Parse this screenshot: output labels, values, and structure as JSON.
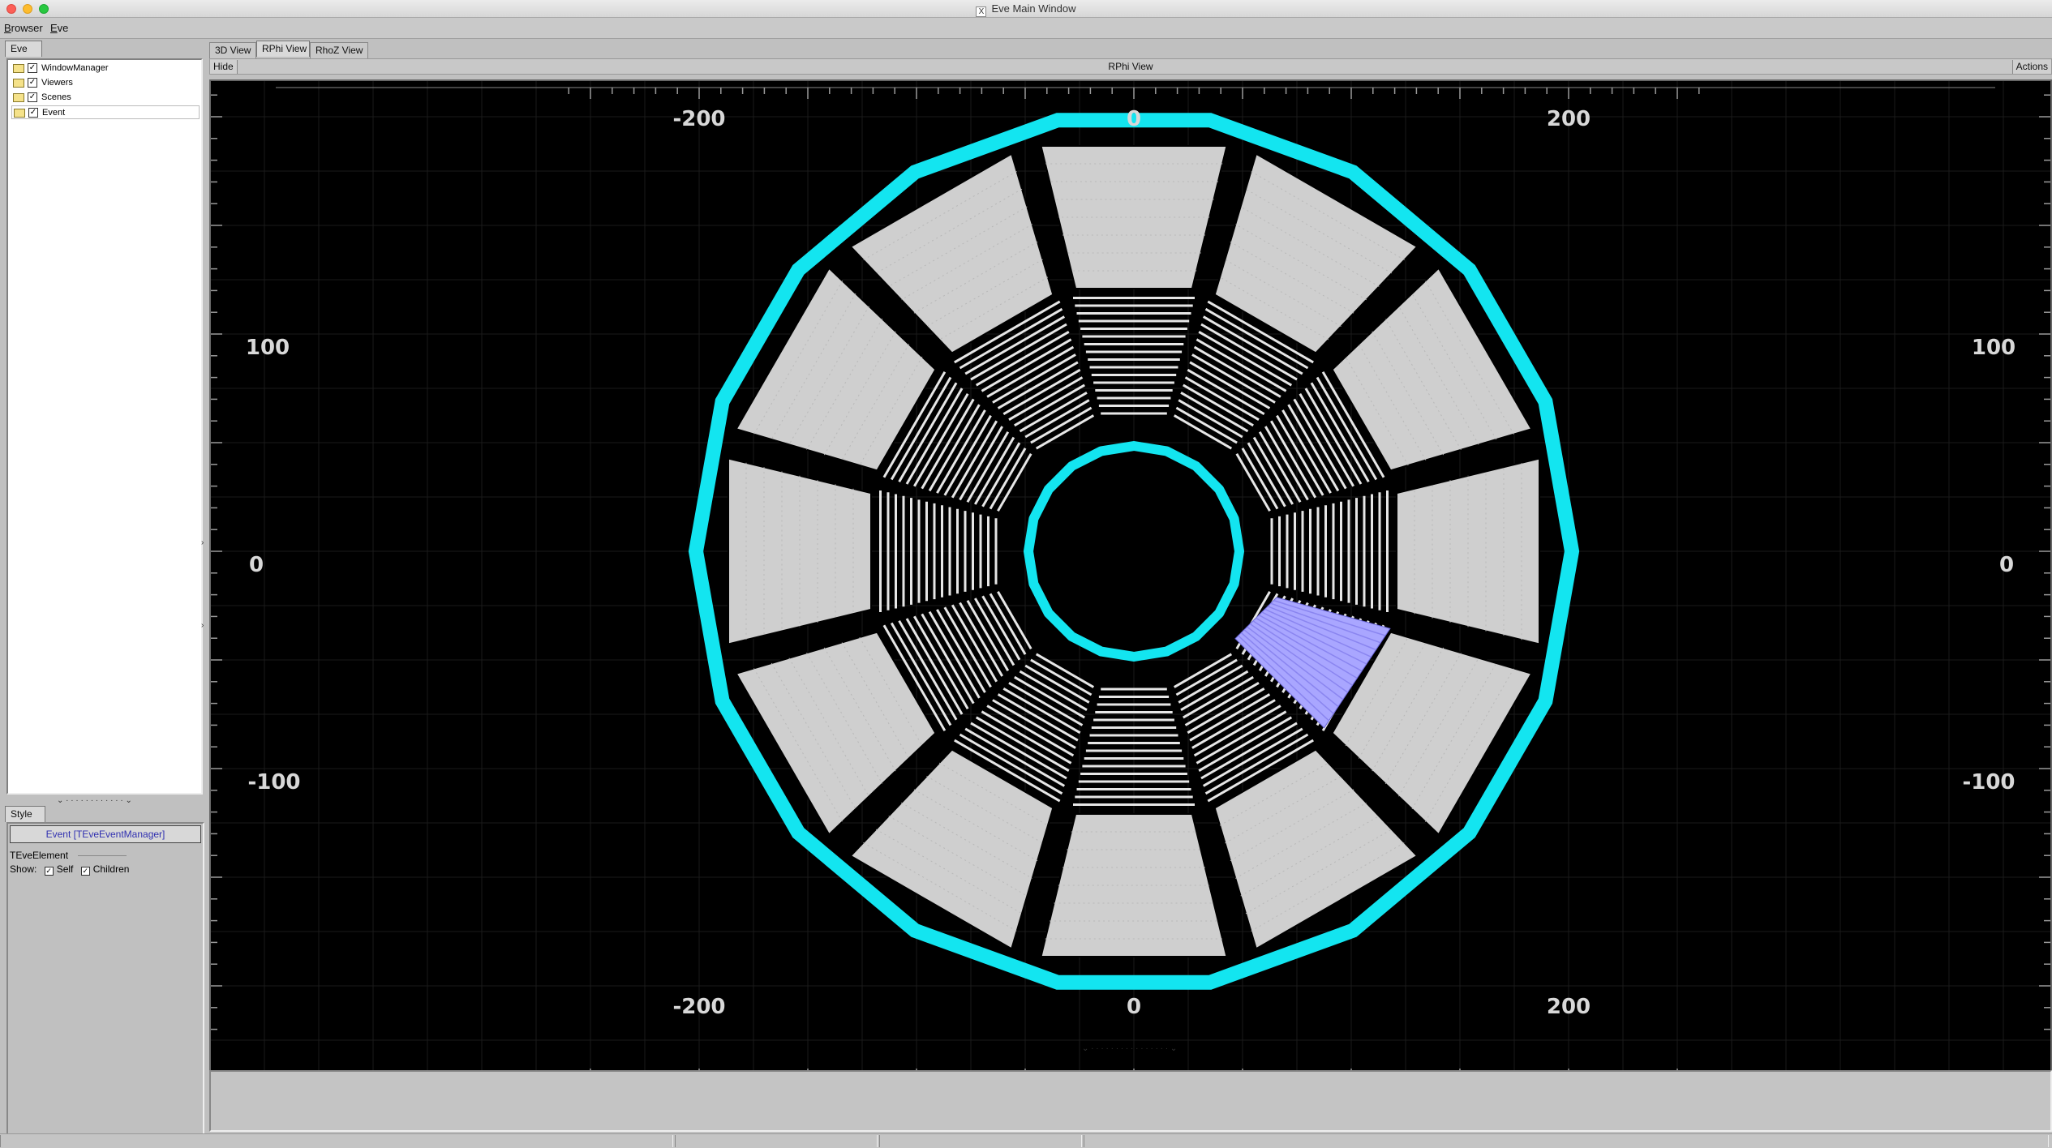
{
  "window": {
    "title": "Eve Main Window",
    "x11_icon": "X"
  },
  "menubar": {
    "items": [
      {
        "label": "Browser",
        "underline": "B",
        "rest": "rowser"
      },
      {
        "label": "Eve",
        "underline": "E",
        "rest": "ve"
      }
    ]
  },
  "left_panel": {
    "top_tab": "Eve",
    "tree": [
      {
        "label": "WindowManager",
        "checked": true
      },
      {
        "label": "Viewers",
        "checked": true
      },
      {
        "label": "Scenes",
        "checked": true
      },
      {
        "label": "Event",
        "checked": true,
        "selected": true
      }
    ],
    "style_tab": "Style",
    "event_button": "Event [TEveEventManager]",
    "element_label": "TEveElement",
    "show_label": "Show:",
    "self_label": "Self",
    "children_label": "Children"
  },
  "view_tabs": [
    {
      "label": "3D View",
      "active": false
    },
    {
      "label": "RPhi View",
      "active": true
    },
    {
      "label": "RhoZ View",
      "active": false
    }
  ],
  "view_header": {
    "hide": "Hide",
    "title": "RPhi View",
    "actions": "Actions"
  },
  "axes": {
    "x_labels": [
      "-200",
      "0",
      "200"
    ],
    "y_labels": [
      "100",
      "0",
      "-100"
    ]
  },
  "colors": {
    "ring": "#13e5f0",
    "module_fill": "#cfcfcf",
    "highlight": "#a9a6ff",
    "background": "#000000"
  }
}
